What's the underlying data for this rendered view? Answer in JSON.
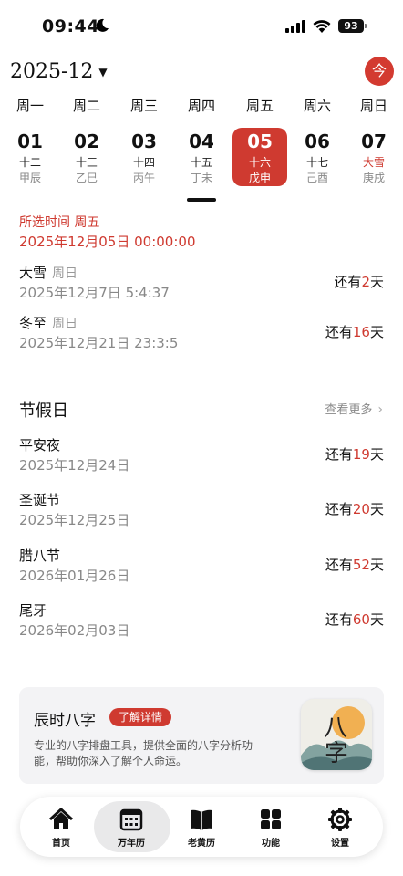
{
  "status": {
    "time": "09:44",
    "battery": "93"
  },
  "header": {
    "month": "2025-12",
    "today_label": "今"
  },
  "weekdays": [
    "周一",
    "周二",
    "周三",
    "周四",
    "周五",
    "周六",
    "周日"
  ],
  "days": [
    {
      "num": "01",
      "lunar": "十二",
      "gz": "甲辰"
    },
    {
      "num": "02",
      "lunar": "十三",
      "gz": "乙巳"
    },
    {
      "num": "03",
      "lunar": "十四",
      "gz": "丙午"
    },
    {
      "num": "04",
      "lunar": "十五",
      "gz": "丁未"
    },
    {
      "num": "05",
      "lunar": "十六",
      "gz": "戊申"
    },
    {
      "num": "06",
      "lunar": "十七",
      "gz": "己酉"
    },
    {
      "num": "07",
      "lunar": "大雪",
      "gz": "庚戌"
    }
  ],
  "selected": {
    "label": "所选时间  周五",
    "value": "2025年12月05日 00:00:00"
  },
  "solar_terms": [
    {
      "name": "大雪",
      "week": "周日",
      "date": "2025年12月7日 5:4:37",
      "prefix": "还有",
      "days": "2",
      "suffix": "天"
    },
    {
      "name": "冬至",
      "week": "周日",
      "date": "2025年12月21日 23:3:5",
      "prefix": "还有",
      "days": "16",
      "suffix": "天"
    }
  ],
  "holidays_section": {
    "title": "节假日",
    "more": "查看更多"
  },
  "holidays": [
    {
      "name": "平安夜",
      "date": "2025年12月24日",
      "prefix": "还有",
      "days": "19",
      "suffix": "天"
    },
    {
      "name": "圣诞节",
      "date": "2025年12月25日",
      "prefix": "还有",
      "days": "20",
      "suffix": "天"
    },
    {
      "name": "腊八节",
      "date": "2026年01月26日",
      "prefix": "还有",
      "days": "52",
      "suffix": "天"
    },
    {
      "name": "尾牙",
      "date": "2026年02月03日",
      "prefix": "还有",
      "days": "60",
      "suffix": "天"
    }
  ],
  "promo": {
    "title": "辰时八字",
    "button": "了解详情",
    "desc": "专业的八字排盘工具，提供全面的八字分析功能，帮助你深入了解个人命运。",
    "logo_text_top": "八",
    "logo_text_bottom": "字"
  },
  "tabs": [
    {
      "label": "首页",
      "icon": "home-icon"
    },
    {
      "label": "万年历",
      "icon": "calendar-icon"
    },
    {
      "label": "老黄历",
      "icon": "book-icon"
    },
    {
      "label": "功能",
      "icon": "grid-icon"
    },
    {
      "label": "设置",
      "icon": "gear-icon"
    }
  ],
  "colors": {
    "accent": "#cf3a30",
    "text": "#111111",
    "muted": "#888888",
    "card": "#f3f3f5"
  }
}
